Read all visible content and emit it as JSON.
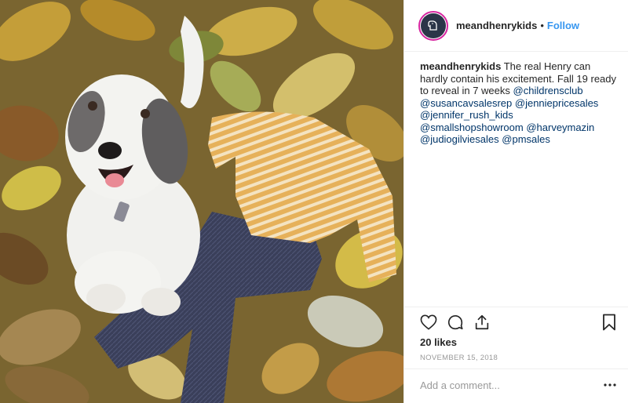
{
  "post": {
    "username": "meandhenrykids",
    "follow_label": "Follow",
    "separator": "•"
  },
  "caption": {
    "username": "meandhenrykids",
    "text": "The real Henry can hardly contain his excitement. Fall 19 ready to reveal in 7 weeks",
    "mentions": [
      "@childrensclub",
      "@susancavsalesrep",
      "@jenniepricesales",
      "@jennifer_rush_kids",
      "@smallshopshowroom",
      "@harveymazin",
      "@judiogilviesales",
      "@pmsales"
    ]
  },
  "actions": {
    "icons": [
      "heart-icon",
      "comment-icon",
      "share-icon",
      "bookmark-icon"
    ]
  },
  "likes": "20 likes",
  "date": "NOVEMBER 15, 2018",
  "comment_box": {
    "placeholder": "Add a comment...",
    "value": ""
  },
  "colors": {
    "follow": "#3897f0",
    "mention": "#003569",
    "text": "#262626",
    "muted": "#999999",
    "divider": "#efefef"
  }
}
